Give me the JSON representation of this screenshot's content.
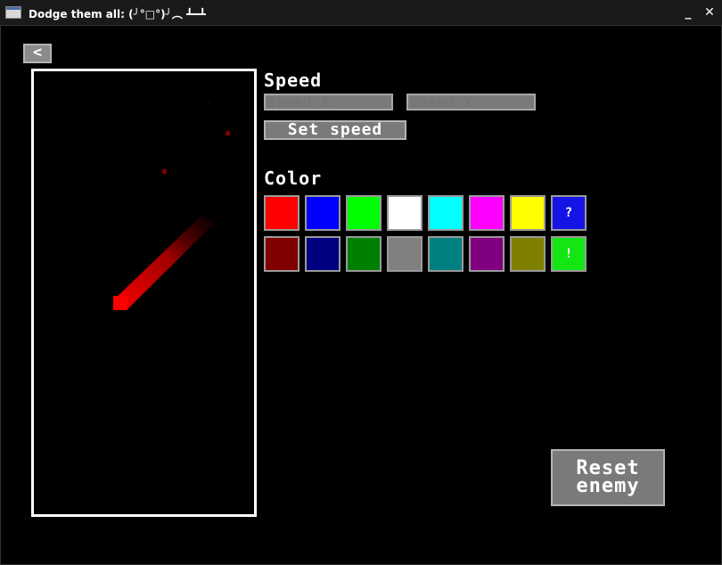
{
  "window": {
    "title": "Dodge them all: (╯°□°)╯︵ ┻━┻",
    "minimize_glyph": "_",
    "close_glyph": "✕"
  },
  "back_button": {
    "glyph": "<"
  },
  "speed": {
    "label": "Speed",
    "speed_x_placeholder": "Speed X",
    "speed_y_placeholder": "Speed Y",
    "set_button": "Set speed"
  },
  "color": {
    "label": "Color",
    "swatches_row1": [
      {
        "name": "red",
        "hex": "#ff0000",
        "glyph": ""
      },
      {
        "name": "blue",
        "hex": "#0000ff",
        "glyph": ""
      },
      {
        "name": "lime",
        "hex": "#00ff00",
        "glyph": ""
      },
      {
        "name": "white",
        "hex": "#ffffff",
        "glyph": ""
      },
      {
        "name": "cyan",
        "hex": "#00ffff",
        "glyph": ""
      },
      {
        "name": "magenta",
        "hex": "#ff00ff",
        "glyph": ""
      },
      {
        "name": "yellow",
        "hex": "#ffff00",
        "glyph": ""
      },
      {
        "name": "random",
        "hex": "#1414e6",
        "glyph": "?"
      }
    ],
    "swatches_row2": [
      {
        "name": "maroon",
        "hex": "#800000",
        "glyph": ""
      },
      {
        "name": "navy",
        "hex": "#000080",
        "glyph": ""
      },
      {
        "name": "green",
        "hex": "#008000",
        "glyph": ""
      },
      {
        "name": "gray",
        "hex": "#808080",
        "glyph": ""
      },
      {
        "name": "teal",
        "hex": "#008080",
        "glyph": ""
      },
      {
        "name": "purple",
        "hex": "#800080",
        "glyph": ""
      },
      {
        "name": "olive",
        "hex": "#808000",
        "glyph": ""
      },
      {
        "name": "custom",
        "hex": "#14e614",
        "glyph": "!"
      }
    ]
  },
  "reset_button": {
    "line1": "Reset",
    "line2": "enemy"
  },
  "preview": {
    "enemy_color": "#ff0000"
  }
}
